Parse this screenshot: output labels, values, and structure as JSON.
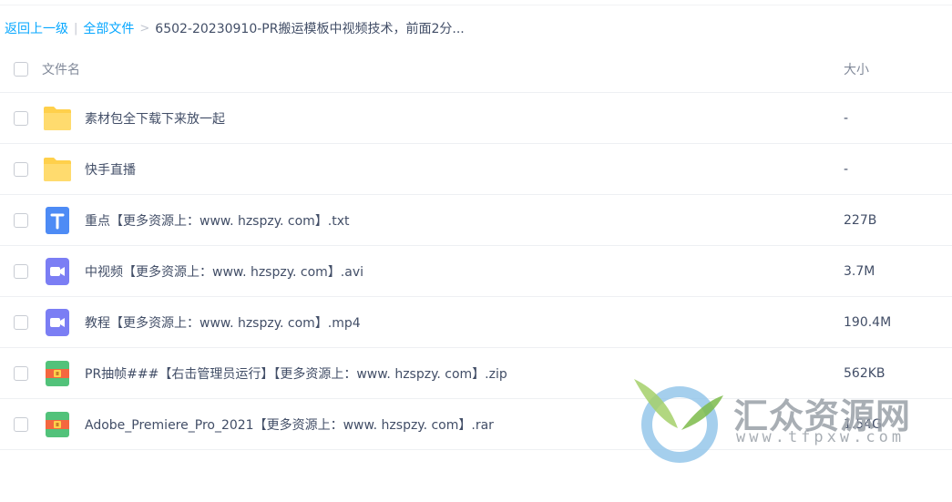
{
  "breadcrumb": {
    "back": "返回上一级",
    "separator1": "|",
    "all_files": "全部文件",
    "separator2": ">",
    "current": "6502-20230910-PR搬运模板中视频技术，前面2分..."
  },
  "table": {
    "headers": {
      "name": "文件名",
      "size": "大小"
    },
    "rows": [
      {
        "name": "素材包全下载下来放一起",
        "size": "-",
        "icon": "folder-icon"
      },
      {
        "name": "快手直播",
        "size": "-",
        "icon": "folder-icon"
      },
      {
        "name": "重点【更多资源上：www. hzspzy. com】.txt",
        "size": "227B",
        "icon": "text-file-icon"
      },
      {
        "name": "中视频【更多资源上：www. hzspzy. com】.avi",
        "size": "3.7M",
        "icon": "video-file-icon"
      },
      {
        "name": "教程【更多资源上：www. hzspzy. com】.mp4",
        "size": "190.4M",
        "icon": "video-file-icon"
      },
      {
        "name": "PR抽帧###【右击管理员运行】【更多资源上：www. hzspzy. com】.zip",
        "size": "562KB",
        "icon": "archive-file-icon"
      },
      {
        "name": "Adobe_Premiere_Pro_2021【更多资源上：www. hzspzy. com】.rar",
        "size": "1.54G",
        "icon": "archive-file-icon"
      }
    ]
  },
  "watermark": {
    "title": "汇众资源网",
    "url": "www.tfpxw.com"
  },
  "colors": {
    "link": "#06a7ff",
    "folder": "#ffd04b",
    "text_icon": "#4d8bf5",
    "video_icon": "#7b7ef4",
    "archive_green": "#52c27a",
    "archive_red": "#f4673f"
  }
}
